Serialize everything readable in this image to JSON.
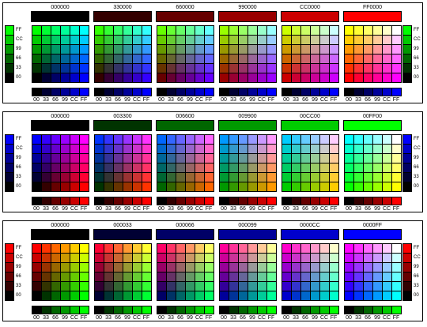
{
  "levels": [
    "00",
    "33",
    "66",
    "99",
    "CC",
    "FF"
  ],
  "side_labels": [
    "FF",
    "CC",
    "99",
    "66",
    "33",
    "00"
  ],
  "bottom_labels": [
    "00",
    "33",
    "66",
    "99",
    "CC",
    "FF"
  ],
  "panels": [
    {
      "name": "red-fixed",
      "fixed_channel": "r",
      "grid_v_channel": "g",
      "grid_h_channel": "b",
      "side_channel": "g",
      "bottom_channel": "b",
      "headers": [
        "000000",
        "330000",
        "660000",
        "990000",
        "CC0000",
        "FF0000"
      ]
    },
    {
      "name": "green-fixed",
      "fixed_channel": "g",
      "grid_v_channel": "b",
      "grid_h_channel": "r",
      "side_channel": "b",
      "bottom_channel": "r",
      "headers": [
        "000000",
        "003300",
        "006600",
        "009900",
        "00CC00",
        "00FF00"
      ]
    },
    {
      "name": "blue-fixed",
      "fixed_channel": "b",
      "grid_v_channel": "r",
      "grid_h_channel": "g",
      "side_channel": "r",
      "bottom_channel": "g",
      "headers": [
        "000000",
        "000033",
        "000066",
        "000099",
        "0000CC",
        "0000FF"
      ]
    }
  ]
}
